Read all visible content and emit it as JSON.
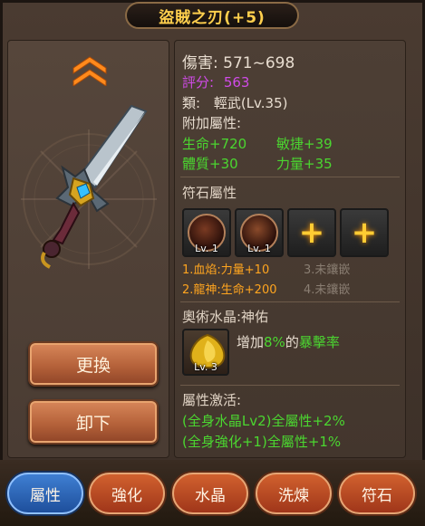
{
  "title": "盜賊之刃(+5)",
  "stats": {
    "damage_label": "傷害:",
    "damage_value": "571~698",
    "rating_label": "評分:",
    "rating_value": "563",
    "type_label": "類:",
    "type_value": "輕武(Lv.35)",
    "extra_label": "附加屬性:",
    "extra": [
      "生命+720",
      "敏捷+39",
      "體質+30",
      "力量+35"
    ]
  },
  "runes": {
    "title": "符石屬性",
    "slot_levels": [
      "Lv. 1",
      "Lv. 1"
    ],
    "plus_glyph": "+",
    "lines": [
      "1.血焰:力量+10",
      "2.龍神:生命+200",
      "3.未鑲嵌",
      "4.未鑲嵌"
    ]
  },
  "crystal": {
    "title": "奧術水晶:神佑",
    "level": "Lv. 3",
    "desc_prefix": "增加",
    "desc_value": "8%",
    "desc_mid": "的",
    "desc_stat": "暴擊率"
  },
  "activation": {
    "title": "屬性激活:",
    "lines": [
      "(全身水晶Lv2)全屬性+2%",
      "(全身強化+1)全屬性+1%"
    ]
  },
  "buttons": {
    "replace": "更換",
    "unequip": "卸下"
  },
  "tabs": [
    "屬性",
    "強化",
    "水晶",
    "洗煉",
    "符石"
  ],
  "colors": {
    "title": "#ffcf4d",
    "green": "#4bd630",
    "orange": "#ffa51f",
    "purple": "#d04be8",
    "active_tab": "#2e66b8"
  }
}
